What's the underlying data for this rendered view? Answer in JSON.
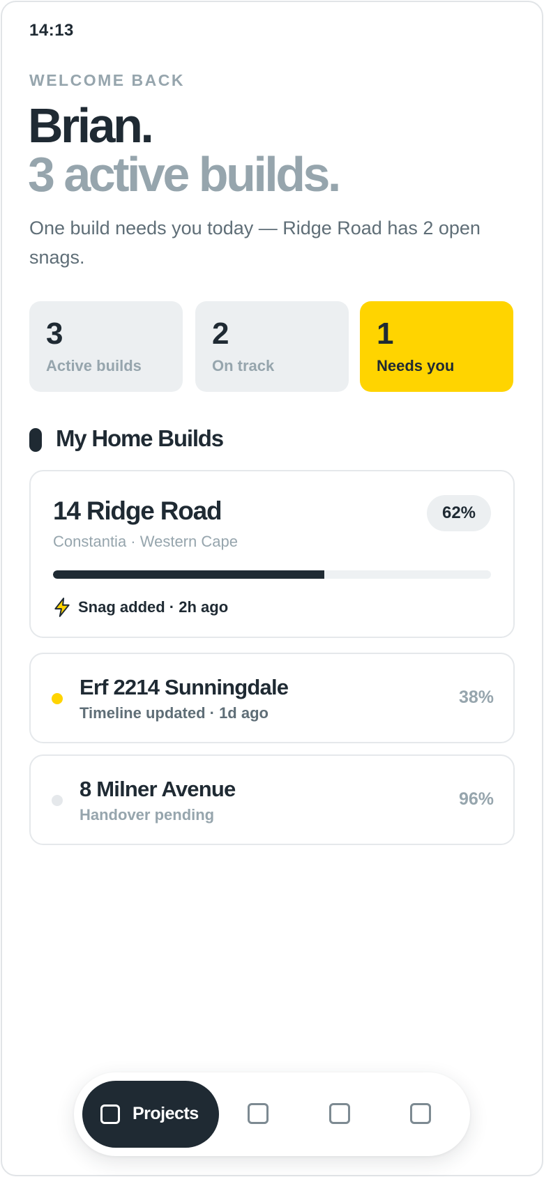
{
  "status_bar": {
    "time": "14:13"
  },
  "greeting": {
    "eyebrow": "WELCOME BACK",
    "name": "Brian.",
    "summary": "3 active builds.",
    "intro": "One build needs you today — Ridge Road has 2 open snags."
  },
  "stats": [
    {
      "value": "3",
      "label": "Active builds"
    },
    {
      "value": "2",
      "label": "On track"
    },
    {
      "value": "1",
      "label": "Needs you",
      "highlight_color": "#ffd400"
    }
  ],
  "section": {
    "title": "My Home Builds"
  },
  "featured_build": {
    "title": "14 Ridge Road",
    "location": "Constantia · Western Cape",
    "percent_label": "62%",
    "progress": 0.62,
    "activity_icon": "lightning-bolt-icon",
    "activity": "Snag added · 2h ago"
  },
  "builds": [
    {
      "title": "Erf 2214 Sunningdale",
      "subtitle": "Timeline updated · 1d ago",
      "percent_label": "38%",
      "dot_color": "#ffd400",
      "subtitle_color": "#5f6e77"
    },
    {
      "title": "8 Milner Avenue",
      "subtitle": "Handover pending",
      "percent_label": "96%",
      "dot_color": "#e5e8eb",
      "subtitle_color": "#96a5ad"
    }
  ],
  "bottom_nav": {
    "active_label": "Projects",
    "tab_icons": [
      "projects-icon",
      "tab-2-icon",
      "tab-3-icon",
      "tab-4-icon"
    ]
  },
  "colors": {
    "ink": "#1f2a33",
    "muted": "#96a5ad",
    "accent": "#ffd400",
    "surface": "#eceff1"
  }
}
